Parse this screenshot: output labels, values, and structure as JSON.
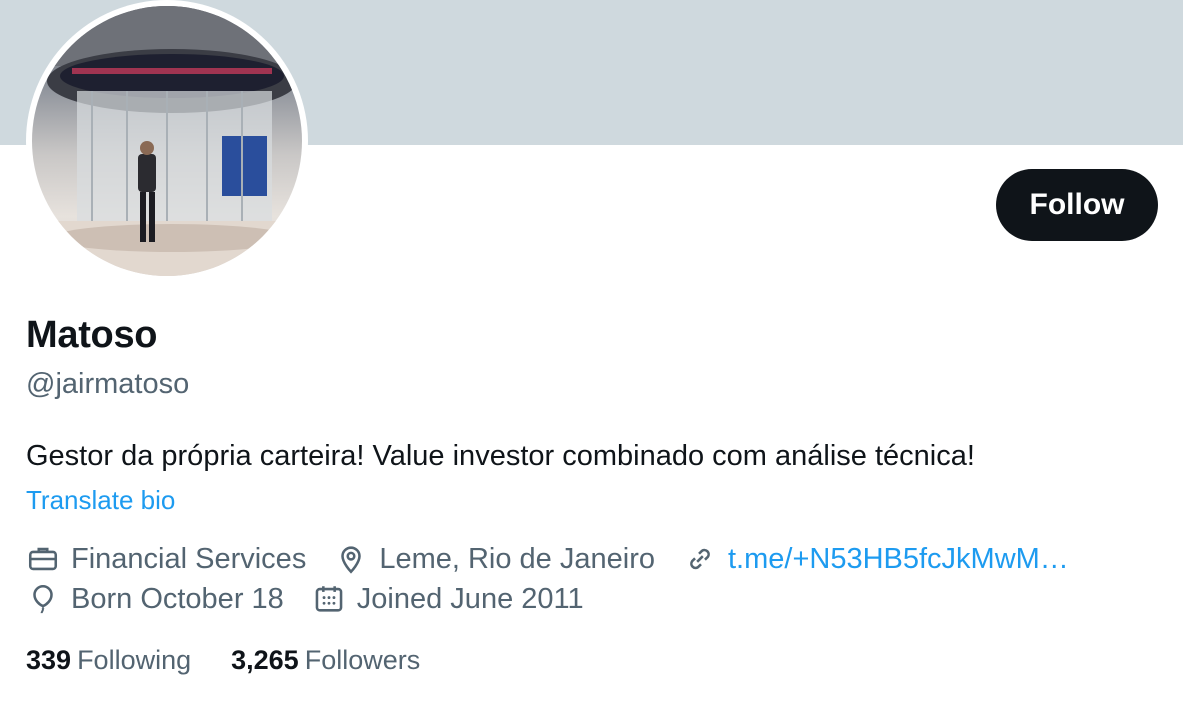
{
  "profile": {
    "display_name": "Matoso",
    "handle": "@jairmatoso",
    "bio": "Gestor da própria carteira! Value investor combinado com análise técnica!",
    "translate_label": "Translate bio",
    "follow_label": "Follow",
    "category": "Financial Services",
    "location": "Leme, Rio de Janeiro",
    "website": "t.me/+N53HB5fcJkMwM…",
    "birthday": "Born October 18",
    "joined": "Joined June 2011",
    "following_count": "339",
    "following_label": "Following",
    "followers_count": "3,265",
    "followers_label": "Followers"
  },
  "colors": {
    "banner": "#cfd9de",
    "accent": "#1d9bf0",
    "text_primary": "#0f1419",
    "text_secondary": "#536471",
    "button_bg": "#0f1419"
  },
  "icons": {
    "category": "briefcase-icon",
    "location": "location-pin-icon",
    "website": "link-icon",
    "birthday": "balloon-icon",
    "joined": "calendar-icon"
  }
}
